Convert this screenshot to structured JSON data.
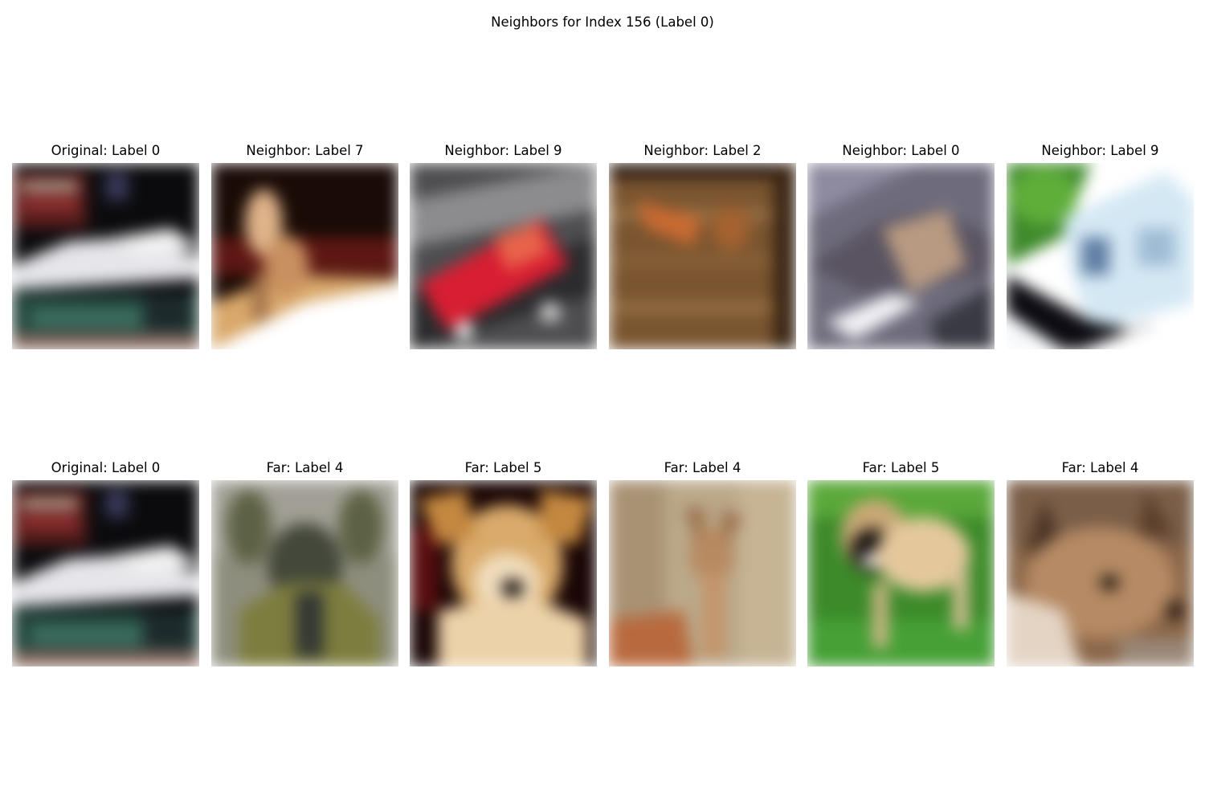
{
  "figure": {
    "title": "Neighbors for Index 156 (Label 0)"
  },
  "rows": [
    {
      "panels": [
        {
          "title": "Original: Label 0"
        },
        {
          "title": "Neighbor: Label 7"
        },
        {
          "title": "Neighbor: Label 9"
        },
        {
          "title": "Neighbor: Label 2"
        },
        {
          "title": "Neighbor: Label 0"
        },
        {
          "title": "Neighbor: Label 9"
        }
      ]
    },
    {
      "panels": [
        {
          "title": "Original: Label 0"
        },
        {
          "title": "Far: Label 4"
        },
        {
          "title": "Far: Label 5"
        },
        {
          "title": "Far: Label 4"
        },
        {
          "title": "Far: Label 5"
        },
        {
          "title": "Far: Label 4"
        }
      ]
    }
  ]
}
